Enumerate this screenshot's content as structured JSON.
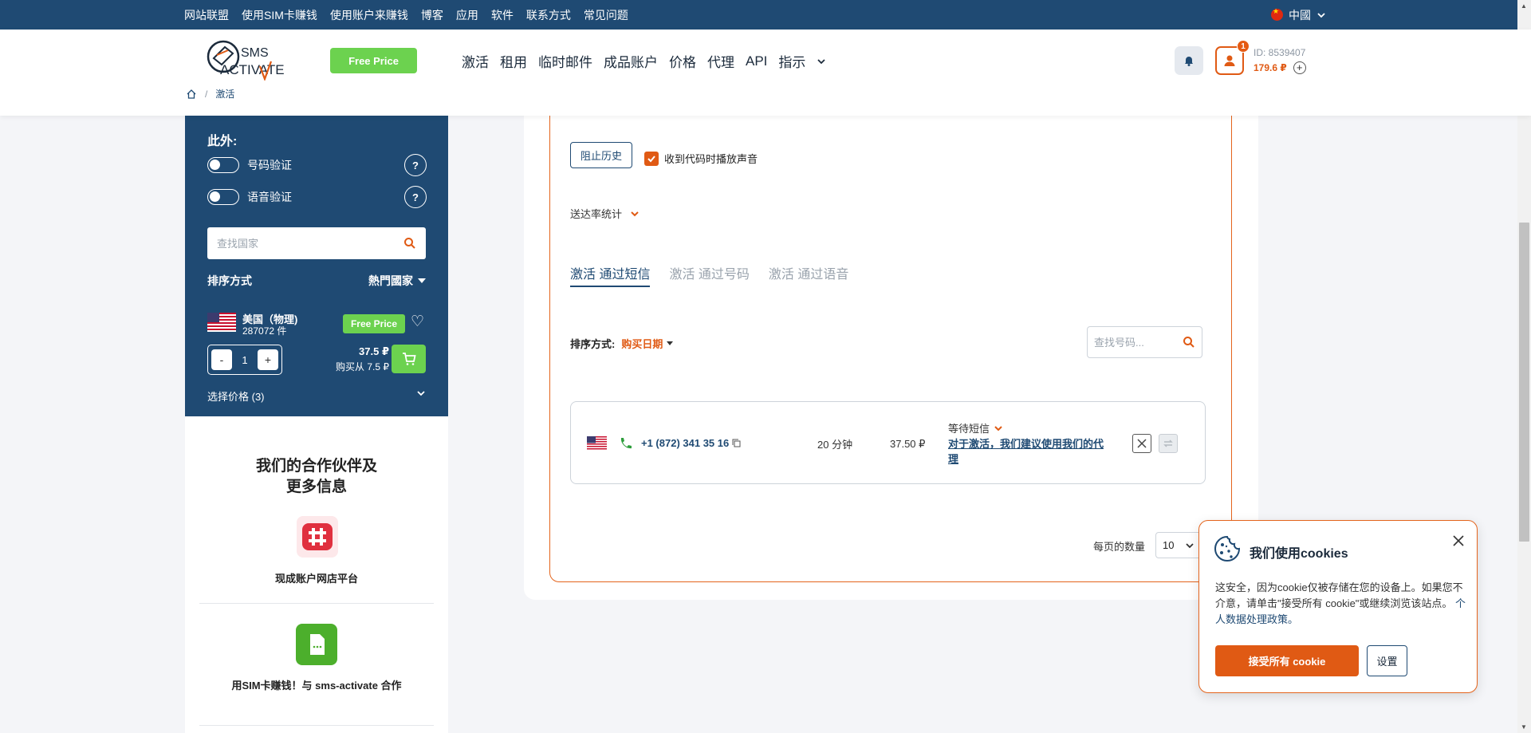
{
  "topbar": {
    "links": [
      "网站联盟",
      "使用SIM卡赚钱",
      "使用账户来赚钱",
      "博客",
      "应用",
      "软件",
      "联系方式",
      "常见问题"
    ],
    "language": "中國"
  },
  "header": {
    "logo_text_top": "SMS",
    "logo_text_bottom": "ACTIVATE",
    "free_price_label": "Free Price",
    "nav": [
      "激活",
      "租用",
      "临时邮件",
      "成品账户",
      "价格",
      "代理",
      "API",
      "指示"
    ],
    "breadcrumb_current": "激活",
    "notification_badge": "1",
    "account_id": "ID: 8539407",
    "balance": "179.6 ₽"
  },
  "sidebar": {
    "also_title": "此外:",
    "toggle_number_verify": "号码验证",
    "toggle_voice_verify": "语音验证",
    "help_mark": "?",
    "country_search_placeholder": "查找国家",
    "sort_label": "排序方式",
    "sort_value": "熱門國家",
    "country": {
      "name": "美国（物理)",
      "count": "287072 件",
      "free_price": "Free Price",
      "quantity": "1",
      "minus": "-",
      "plus": "+",
      "price": "37.5 ₽",
      "buy_from": "购买从 7.5 ₽"
    },
    "select_price": "选择价格 (3)",
    "partners_title_line1": "我们的合作伙伴及",
    "partners_title_line2": "更多信息",
    "partner1_label": "现成账户网店平台",
    "partner2_label": "用SIM卡赚钱！与 sms-activate 合作"
  },
  "main": {
    "block_history": "阻止历史",
    "play_sound_label": "收到代码时播放声音",
    "delivery_stats": "送达率统计",
    "tabs": [
      "激活 通过短信",
      "激活 通过号码",
      "激活 通过语音"
    ],
    "sort_label": "排序方式:",
    "sort_value": "购买日期",
    "number_search_placeholder": "查找号码...",
    "row": {
      "phone": "+1 (872) 341 35 16",
      "time": "20 分钟",
      "price": "37.50 ₽",
      "status": "等待短信",
      "proxy_link": "对于激活，我们建议使用我们的代理"
    },
    "per_page_label": "每页的数量",
    "per_page_value": "10"
  },
  "cookie": {
    "title": "我们使用cookies",
    "text": "这安全，因为cookie仅被存储在您的设备上。如果您不介意，请单击\"接受所有 cookie\"或继续浏览该站点。",
    "policy_link": "个人数据处理政策。",
    "accept_label": "接受所有 cookie",
    "settings_label": "设置"
  },
  "colors": {
    "brand_blue": "#1f4a73",
    "accent_orange": "#e05a14",
    "green": "#6cd24f"
  }
}
